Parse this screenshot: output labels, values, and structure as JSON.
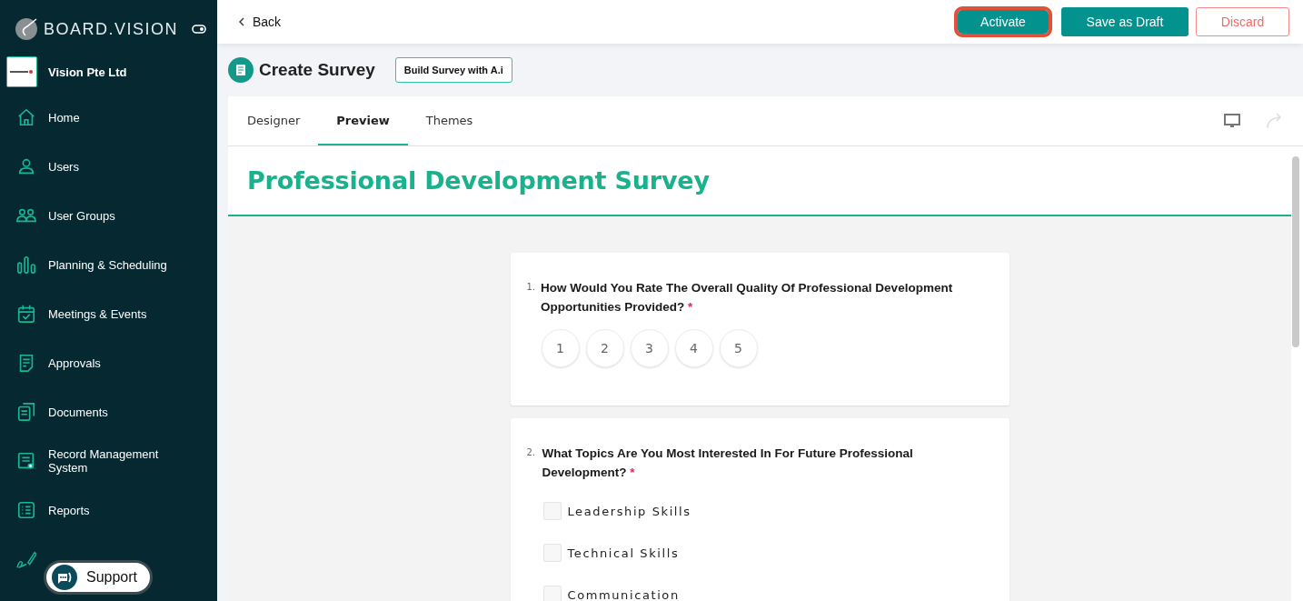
{
  "sidebar": {
    "brand": "BOARD.VISION",
    "company": "Vision Pte Ltd",
    "items": [
      {
        "kind": "home",
        "label": "Home"
      },
      {
        "kind": "user",
        "label": "Users"
      },
      {
        "kind": "users",
        "label": "User Groups"
      },
      {
        "kind": "bars",
        "label": "Planning & Scheduling"
      },
      {
        "kind": "calendar",
        "label": "Meetings & Events"
      },
      {
        "kind": "doc",
        "label": "Approvals"
      },
      {
        "kind": "docs",
        "label": "Documents"
      },
      {
        "kind": "record",
        "label": "Record Management System"
      },
      {
        "kind": "list",
        "label": "Reports"
      },
      {
        "kind": "pen"
      }
    ],
    "support": "Support"
  },
  "topbar": {
    "back": "Back",
    "buttons": [
      {
        "label": "Activate",
        "kind": "primary",
        "highlighted": true
      },
      {
        "label": "Save as Draft",
        "kind": "primary",
        "highlighted": false
      },
      {
        "label": "Discard",
        "kind": "outline",
        "highlighted": false
      }
    ]
  },
  "header": {
    "title": "Create Survey",
    "ai_button": "Build Survey with A.i"
  },
  "tabs": [
    {
      "label": "Designer",
      "selected": false
    },
    {
      "label": "Preview",
      "selected": true
    },
    {
      "label": "Themes",
      "selected": false
    }
  ],
  "survey": {
    "title": "Professional Development Survey",
    "questions": [
      {
        "number": "1.",
        "kind": "rating",
        "text": "How Would You Rate The Overall Quality Of Professional Development Opportunities Provided?",
        "required_mark": "*",
        "options": [
          {
            "label": "1",
            "selected": false
          },
          {
            "label": "2",
            "selected": false
          },
          {
            "label": "3",
            "selected": false
          },
          {
            "label": "4",
            "selected": false
          },
          {
            "label": "5",
            "selected": false
          }
        ]
      },
      {
        "number": "2.",
        "kind": "checkbox",
        "text": "What Topics Are You Most Interested In For Future Professional Development?",
        "required_mark": "*",
        "options": [
          {
            "label": "Leadership Skills",
            "checked": false
          },
          {
            "label": "Technical Skills",
            "checked": false
          },
          {
            "label": "Communication",
            "checked": false
          }
        ]
      }
    ]
  }
}
